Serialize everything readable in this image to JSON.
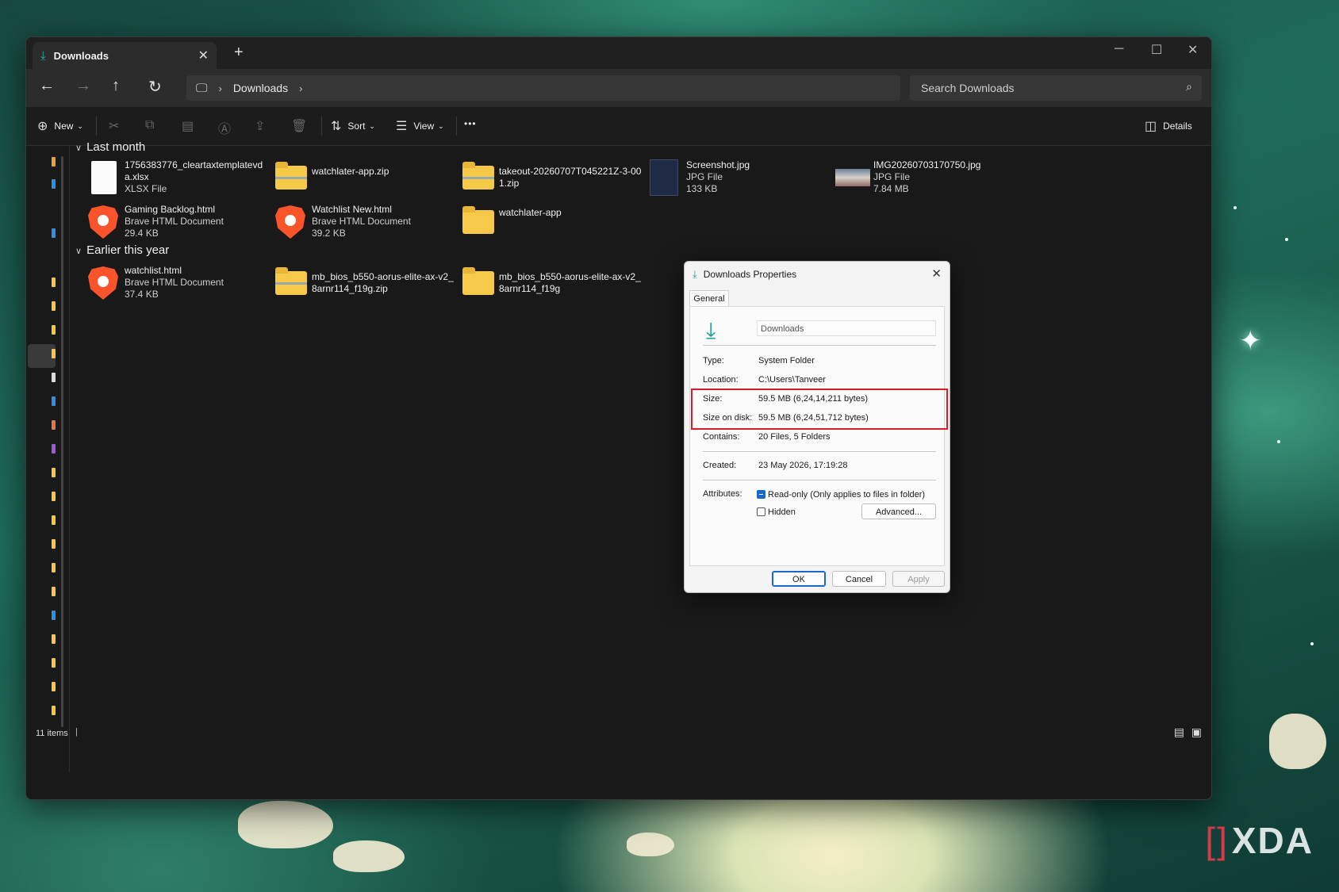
{
  "window": {
    "tab_title": "Downloads",
    "breadcrumb": [
      "Downloads"
    ],
    "search_placeholder": "Search Downloads"
  },
  "commands": {
    "new_label": "New",
    "sort_label": "Sort",
    "view_label": "View",
    "more_label": "•••",
    "details_label": "Details"
  },
  "groups": [
    {
      "label": "Last month",
      "items": [
        {
          "name": "1756383776_cleartaxtemplatevda.xlsx",
          "type": "XLSX File",
          "size": "",
          "icon": "xlsx-file-icon"
        },
        {
          "name": "watchlater-app.zip",
          "type": "",
          "size": "",
          "icon": "zip-folder-icon"
        },
        {
          "name": "takeout-20260707T045221Z-3-001.zip",
          "type": "",
          "size": "",
          "icon": "zip-folder-icon"
        },
        {
          "name": "Screenshot.jpg",
          "type": "JPG File",
          "size": "133 KB",
          "icon": "image-thumbnail-icon"
        },
        {
          "name": "IMG20260703170750.jpg",
          "type": "JPG File",
          "size": "7.84 MB",
          "icon": "image-thumbnail-icon"
        },
        {
          "name": "Gaming Backlog.html",
          "type": "Brave HTML Document",
          "size": "29.4 KB",
          "icon": "brave-browser-icon"
        },
        {
          "name": "Watchlist New.html",
          "type": "Brave HTML Document",
          "size": "39.2 KB",
          "icon": "brave-browser-icon"
        },
        {
          "name": "watchlater-app",
          "type": "",
          "size": "",
          "icon": "folder-icon"
        }
      ]
    },
    {
      "label": "Earlier this year",
      "items": [
        {
          "name": "watchlist.html",
          "type": "Brave HTML Document",
          "size": "37.4 KB",
          "icon": "brave-browser-icon"
        },
        {
          "name": "mb_bios_b550-aorus-elite-ax-v2_8arnr114_f19g.zip",
          "type": "",
          "size": "",
          "icon": "zip-folder-icon"
        },
        {
          "name": "mb_bios_b550-aorus-elite-ax-v2_8arnr114_f19g",
          "type": "",
          "size": "",
          "icon": "folder-icon"
        }
      ]
    }
  ],
  "status": {
    "items_count": "11 items"
  },
  "dialog": {
    "title": "Downloads Properties",
    "tab": "General",
    "folder_name": "Downloads",
    "rows": {
      "type_label": "Type:",
      "type_value": "System Folder",
      "location_label": "Location:",
      "location_value": "C:\\Users\\Tanveer",
      "size_label": "Size:",
      "size_value": "59.5 MB (6,24,14,211 bytes)",
      "size_on_disk_label": "Size on disk:",
      "size_on_disk_value": "59.5 MB (6,24,51,712 bytes)",
      "contains_label": "Contains:",
      "contains_value": "20 Files, 5 Folders",
      "created_label": "Created:",
      "created_value": "23 May 2026, 17:19:28",
      "attributes_label": "Attributes:"
    },
    "readonly_label": "Read-only (Only applies to files in folder)",
    "readonly_checked": true,
    "hidden_label": "Hidden",
    "hidden_checked": false,
    "advanced_label": "Advanced...",
    "ok_label": "OK",
    "cancel_label": "Cancel",
    "apply_label": "Apply"
  },
  "watermark": {
    "brand": "XDA",
    "bracket": "[]"
  }
}
